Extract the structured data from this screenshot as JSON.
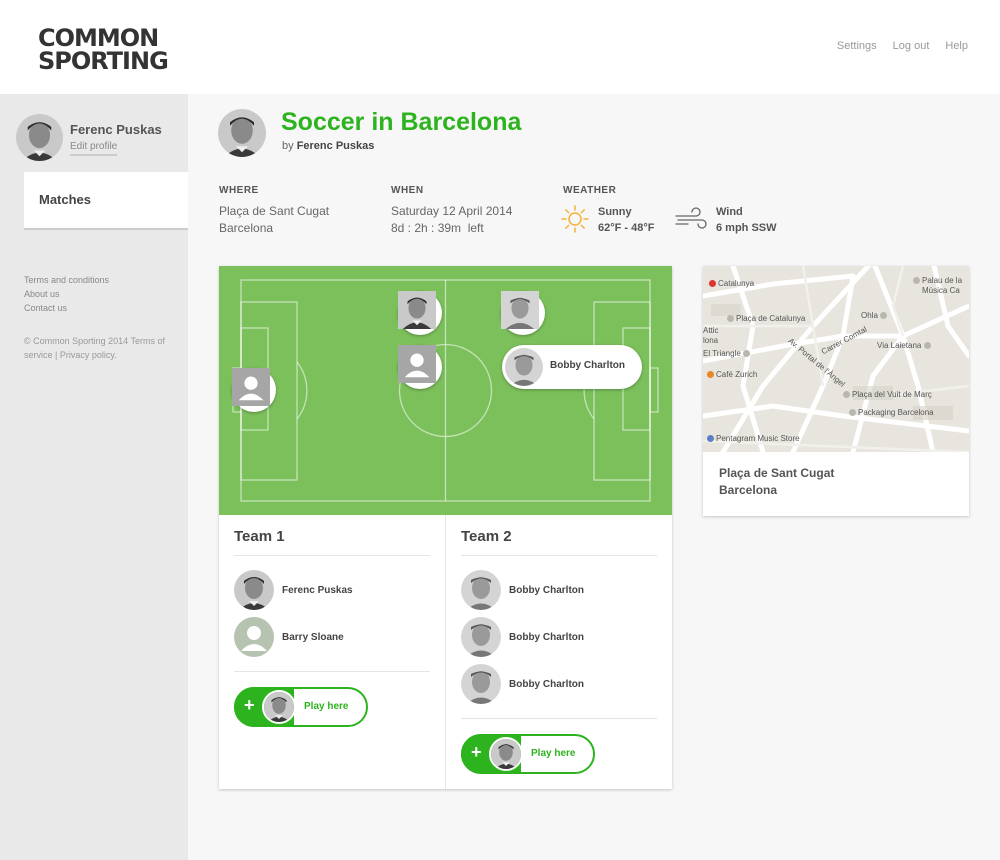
{
  "brand": {
    "line1": "COMMON",
    "line2": "SPORTING"
  },
  "topnav": {
    "settings": "Settings",
    "logout": "Log out",
    "help": "Help"
  },
  "sidebar": {
    "user_name": "Ferenc Puskas",
    "edit_profile": "Edit profile",
    "nav_matches": "Matches",
    "links": {
      "terms": "Terms and conditions",
      "about": "About us",
      "contact": "Contact us"
    },
    "copyright": "© Common Sporting 2014 Terms of service | Privacy policy."
  },
  "event": {
    "title": "Soccer in Barcelona",
    "by_prefix": "by",
    "organizer": "Ferenc Puskas"
  },
  "info": {
    "where_label": "WHERE",
    "where_line1": "Plaça de Sant Cugat",
    "where_line2": "Barcelona",
    "when_label": "WHEN",
    "when_line1": "Saturday 12 April 2014",
    "when_line2": "8d : 2h : 39m  left",
    "weather_label": "WEATHER",
    "weather_cond": "Sunny",
    "weather_temp": "62°F - 48°F",
    "wind_label": "Wind",
    "wind_value": "6 mph SSW"
  },
  "pitch": {
    "highlight_player": "Bobby Charlton"
  },
  "team1": {
    "title": "Team 1",
    "players": [
      "Ferenc Puskas",
      "Barry Sloane"
    ],
    "play_here": "Play here"
  },
  "team2": {
    "title": "Team 2",
    "players": [
      "Bobby Charlton",
      "Bobby Charlton",
      "Bobby Charlton"
    ],
    "play_here": "Play here"
  },
  "map": {
    "labels": {
      "catalunya": "Catalunya",
      "placa_catalunya": "Plaça de Catalunya",
      "palau1": "Palau de la",
      "palau2": "Música Ca",
      "ohla": "Ohla",
      "attic1": "Attic",
      "attic2": "lona",
      "triangle": "El Triangle",
      "carrer_comtal": "Carrer Comtal",
      "portal": "Av. Portal de l'Àngel",
      "laietana": "Via Laietana",
      "zurich": "Café Zurich",
      "vuit_marc": "Plaça del Vuit de Març",
      "packaging": "Packaging Barcelona",
      "pentagram": "Pentagram Music Store"
    },
    "address_line1": "Plaça de Sant Cugat",
    "address_line2": "Barcelona"
  },
  "colors": {
    "accent": "#2db31e",
    "pitch": "#7cc05c",
    "sidebar": "#e9e9e9",
    "sun": "#f4b23a"
  },
  "icons": [
    "sun-icon",
    "wind-icon",
    "plus-icon",
    "person-placeholder-icon",
    "metro-icon"
  ]
}
